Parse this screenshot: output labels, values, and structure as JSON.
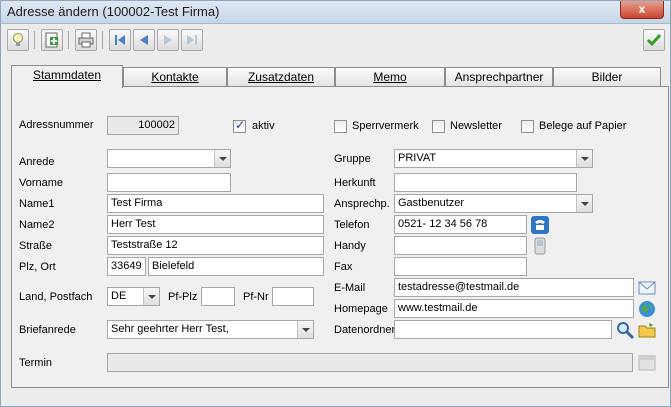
{
  "window": {
    "title": "Adresse ändern (100002-Test Firma)",
    "close_label": "x"
  },
  "toolbar": {
    "icons": [
      "lightbulb-icon",
      "add-record-icon",
      "print-icon",
      "first-record-icon",
      "prev-record-icon",
      "next-record-icon",
      "last-record-icon",
      "confirm-check-icon"
    ]
  },
  "tabs": [
    {
      "label": "Stammdaten",
      "active": true
    },
    {
      "label": "Kontakte"
    },
    {
      "label": "Zusatzdaten"
    },
    {
      "label": "Memo"
    },
    {
      "label": "Ansprechpartner"
    },
    {
      "label": "Bilder"
    }
  ],
  "form": {
    "adressnummer_label": "Adressnummer",
    "adressnummer": "100002",
    "aktiv_label": "aktiv",
    "sperrvermerk_label": "Sperrvermerk",
    "newsletter_label": "Newsletter",
    "belege_label": "Belege auf Papier",
    "anrede_label": "Anrede",
    "anrede": "",
    "vorname_label": "Vorname",
    "vorname": "",
    "name1_label": "Name1",
    "name1": "Test Firma",
    "name2_label": "Name2",
    "name2": "Herr Test",
    "strasse_label": "Straße",
    "strasse": "Teststraße 12",
    "plzort_label": "Plz, Ort",
    "plz": "33649",
    "ort": "Bielefeld",
    "land_label": "Land, Postfach",
    "land": "DE",
    "pfplz_label": "Pf-Plz",
    "pfplz": "",
    "pfnr_label": "Pf-Nr",
    "pfnr": "",
    "briefanrede_label": "Briefanrede",
    "briefanrede": "Sehr geehrter Herr Test,",
    "gruppe_label": "Gruppe",
    "gruppe": "PRIVAT",
    "herkunft_label": "Herkunft",
    "herkunft": "",
    "ansprech_label": "Ansprechp.",
    "ansprech": "Gastbenutzer",
    "telefon_label": "Telefon",
    "telefon": "0521- 12 34 56 78",
    "handy_label": "Handy",
    "handy": "",
    "fax_label": "Fax",
    "fax": "",
    "email_label": "E-Mail",
    "email": "testadresse@testmail.de",
    "homepage_label": "Homepage",
    "homepage": "www.testmail.de",
    "datenordner_label": "Datenordner",
    "datenordner": "",
    "termin_label": "Termin",
    "termin": ""
  }
}
